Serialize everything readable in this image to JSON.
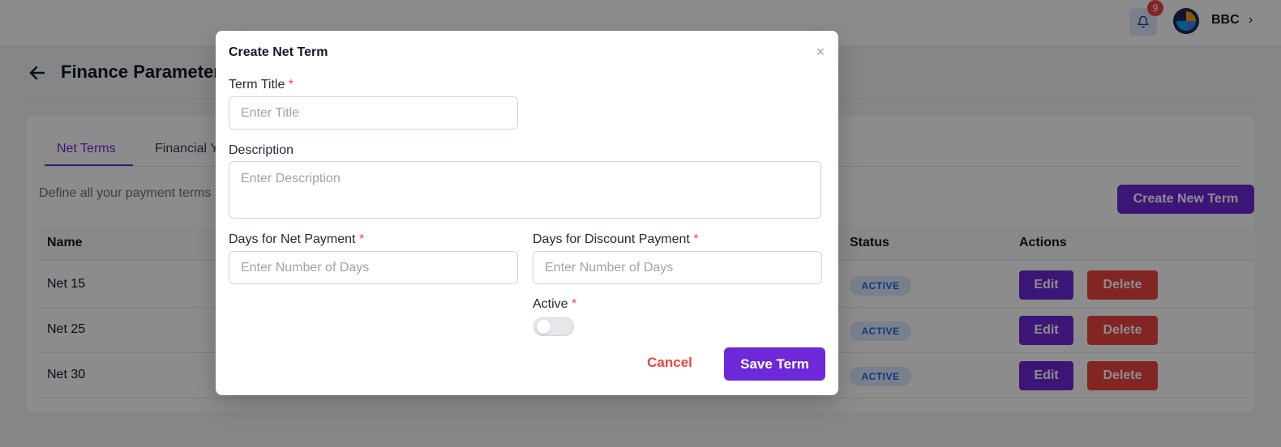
{
  "header": {
    "notification_count": "9",
    "org_name": "BBC",
    "org_chevron": "›"
  },
  "page": {
    "title": "Finance Parameters",
    "tabs": [
      {
        "label": "Net Terms",
        "active": true
      },
      {
        "label": "Financial Years",
        "active": false
      }
    ],
    "intro": "Define all your payment terms here",
    "create_button": "Create New Term"
  },
  "table": {
    "columns": [
      "Name",
      "Status",
      "Actions"
    ],
    "rows": [
      {
        "name": "Net 15",
        "status": "ACTIVE"
      },
      {
        "name": "Net 25",
        "status": "ACTIVE"
      },
      {
        "name": "Net 30",
        "status": "ACTIVE"
      }
    ],
    "edit_label": "Edit",
    "delete_label": "Delete"
  },
  "modal": {
    "title": "Create Net Term",
    "close_icon": "×",
    "required_mark": "*",
    "term_title": {
      "label": "Term Title",
      "placeholder": "Enter Title",
      "value": ""
    },
    "description": {
      "label": "Description",
      "placeholder": "Enter Description",
      "value": ""
    },
    "net_days": {
      "label": "Days for Net Payment",
      "placeholder": "Enter Number of Days",
      "value": ""
    },
    "discount_days": {
      "label": "Days for Discount Payment",
      "placeholder": "Enter Number of Days",
      "value": ""
    },
    "active": {
      "label": "Active",
      "enabled": false
    },
    "cancel_label": "Cancel",
    "save_label": "Save Term"
  },
  "colors": {
    "primary": "#6d28d9",
    "danger": "#ef4444",
    "status_bg": "#dbeafe",
    "status_text": "#2563eb"
  }
}
